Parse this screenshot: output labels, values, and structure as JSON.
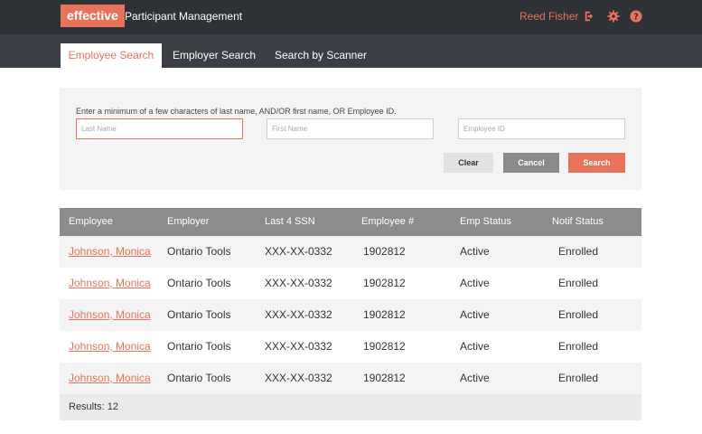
{
  "header": {
    "logo": "effective",
    "title": "Participant Management",
    "user_name": "Reed Fisher",
    "icons": [
      "sign-out-icon",
      "gear-icon",
      "help-icon"
    ],
    "accent_color": "#e8735a"
  },
  "tabs": [
    {
      "label": "Employee Search",
      "active": true
    },
    {
      "label": "Employer Search",
      "active": false
    },
    {
      "label": "Search by Scanner",
      "active": false
    }
  ],
  "search": {
    "instructions": "Enter a minimum of a few characters of last name, AND/OR first name, OR Employee ID.",
    "last_name_placeholder": "Last Name",
    "first_name_placeholder": "First Name",
    "employee_id_placeholder": "Employee ID",
    "clear_label": "Clear",
    "cancel_label": "Cancel",
    "search_label": "Search"
  },
  "table": {
    "columns": [
      "Employee",
      "Employer",
      "Last 4 SSN",
      "Employee #",
      "Emp Status",
      "Notif Status"
    ],
    "rows": [
      {
        "employee": "Johnson, Monica",
        "employer": "Ontario Tools",
        "ssn": "XXX-XX-0332",
        "emp_no": "1902812",
        "status": "Active",
        "notif": "Enrolled"
      },
      {
        "employee": "Johnson, Monica",
        "employer": "Ontario Tools",
        "ssn": "XXX-XX-0332",
        "emp_no": "1902812",
        "status": "Active",
        "notif": "Enrolled"
      },
      {
        "employee": "Johnson, Monica",
        "employer": "Ontario Tools",
        "ssn": "XXX-XX-0332",
        "emp_no": "1902812",
        "status": "Active",
        "notif": "Enrolled"
      },
      {
        "employee": "Johnson, Monica",
        "employer": "Ontario Tools",
        "ssn": "XXX-XX-0332",
        "emp_no": "1902812",
        "status": "Active",
        "notif": "Enrolled"
      },
      {
        "employee": "Johnson, Monica",
        "employer": "Ontario Tools",
        "ssn": "XXX-XX-0332",
        "emp_no": "1902812",
        "status": "Active",
        "notif": "Enrolled"
      }
    ],
    "results_text": "Results: 12"
  }
}
